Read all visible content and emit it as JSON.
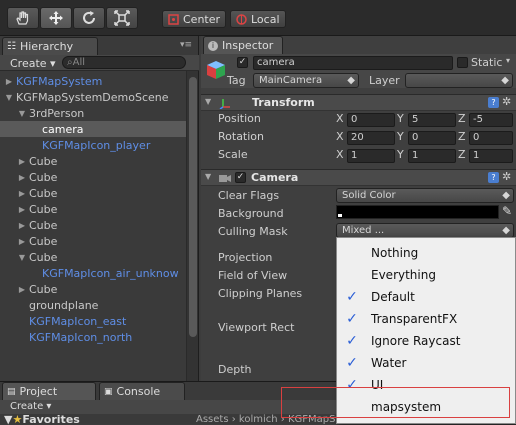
{
  "toolbar": {
    "tools": [
      "hand-icon",
      "move-icon",
      "rotate-icon",
      "scale-icon"
    ],
    "center_label": "Center",
    "local_label": "Local"
  },
  "hierarchy": {
    "tab_label": "Hierarchy",
    "create_label": "Create",
    "search_placeholder": "All",
    "items": [
      {
        "label": "KGFMapSystem",
        "blue": true,
        "arrow": "▶",
        "indent": 0
      },
      {
        "label": "KGFMapSystemDemoScene",
        "blue": false,
        "arrow": "▼",
        "indent": 0
      },
      {
        "label": "3rdPerson",
        "blue": false,
        "arrow": "▼",
        "indent": 1
      },
      {
        "label": "camera",
        "blue": false,
        "arrow": "",
        "indent": 2,
        "selected": true
      },
      {
        "label": "KGFMapIcon_player",
        "blue": true,
        "arrow": "",
        "indent": 2
      },
      {
        "label": "Cube",
        "blue": false,
        "arrow": "▶",
        "indent": 1
      },
      {
        "label": "Cube",
        "blue": false,
        "arrow": "▶",
        "indent": 1
      },
      {
        "label": "Cube",
        "blue": false,
        "arrow": "▶",
        "indent": 1
      },
      {
        "label": "Cube",
        "blue": false,
        "arrow": "▶",
        "indent": 1
      },
      {
        "label": "Cube",
        "blue": false,
        "arrow": "▶",
        "indent": 1
      },
      {
        "label": "Cube",
        "blue": false,
        "arrow": "▶",
        "indent": 1
      },
      {
        "label": "Cube",
        "blue": false,
        "arrow": "▼",
        "indent": 1
      },
      {
        "label": "KGFMapIcon_air_unknow",
        "blue": true,
        "arrow": "",
        "indent": 2
      },
      {
        "label": "Cube",
        "blue": false,
        "arrow": "▶",
        "indent": 1
      },
      {
        "label": "groundplane",
        "blue": false,
        "arrow": "",
        "indent": 1
      },
      {
        "label": "KGFMapIcon_east",
        "blue": true,
        "arrow": "",
        "indent": 1
      },
      {
        "label": "KGFMapIcon_north",
        "blue": true,
        "arrow": "",
        "indent": 1
      }
    ]
  },
  "inspector": {
    "tab_label": "Inspector",
    "object_name": "camera",
    "static_label": "Static",
    "tag_label": "Tag",
    "tag_value": "MainCamera",
    "layer_label": "Layer",
    "transform": {
      "title": "Transform",
      "rows": [
        {
          "label": "Position",
          "x": "0",
          "y": "5",
          "z": "-5"
        },
        {
          "label": "Rotation",
          "x": "20",
          "y": "0",
          "z": "0"
        },
        {
          "label": "Scale",
          "x": "1",
          "y": "1",
          "z": "1"
        }
      ],
      "axis_x": "X",
      "axis_y": "Y",
      "axis_z": "Z"
    },
    "camera": {
      "title": "Camera",
      "clear_flags_label": "Clear Flags",
      "clear_flags_value": "Solid Color",
      "background_label": "Background",
      "culling_mask_label": "Culling Mask",
      "culling_mask_value": "Mixed ...",
      "projection_label": "Projection",
      "fov_label": "Field of View",
      "clipping_label": "Clipping Planes",
      "viewport_label": "Viewport Rect",
      "depth_label": "Depth"
    }
  },
  "culling_menu": {
    "items": [
      {
        "label": "Nothing",
        "checked": false
      },
      {
        "label": "Everything",
        "checked": false
      },
      {
        "label": "Default",
        "checked": true
      },
      {
        "label": "TransparentFX",
        "checked": true
      },
      {
        "label": "Ignore Raycast",
        "checked": true
      },
      {
        "label": "Water",
        "checked": true
      },
      {
        "label": "UI",
        "checked": true
      },
      {
        "label": "mapsystem",
        "checked": false
      }
    ]
  },
  "bottom": {
    "project_tab": "Project",
    "console_tab": "Console",
    "create_label": "Create",
    "favorites_label": "Favorites",
    "path_text": "Assets › kolmich › KGFMapSystem › demo › scenes"
  },
  "colors": {
    "accent_blue": "#5f8ee6",
    "highlight_red": "#d94040",
    "check_blue": "#2a5ed6"
  }
}
